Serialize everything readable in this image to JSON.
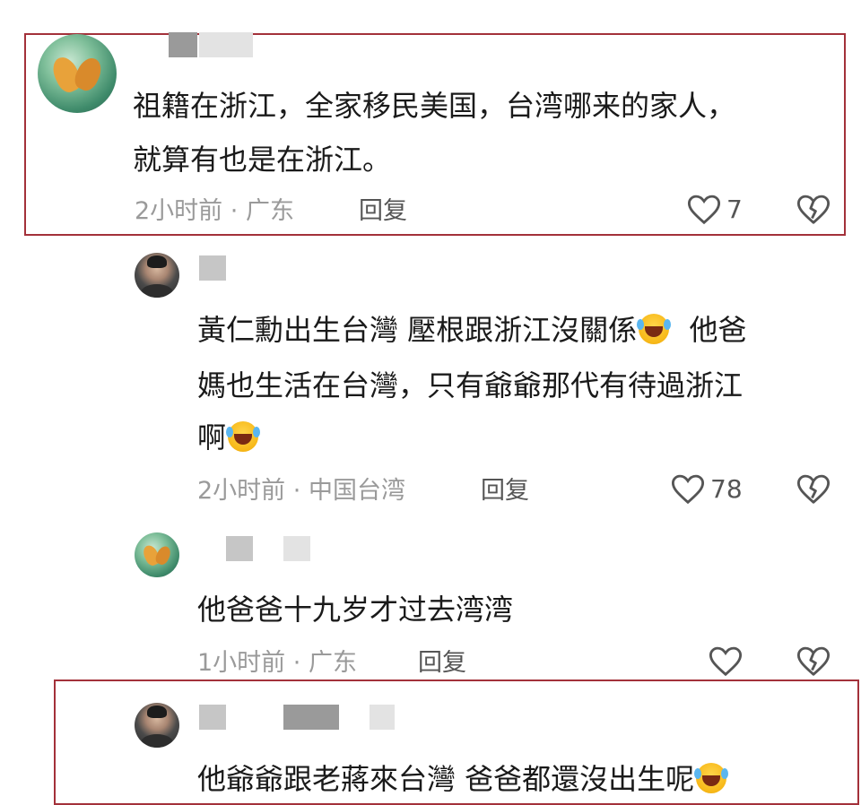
{
  "comments": [
    {
      "text_lines": [
        "祖籍在浙江，全家移民美国，台湾哪来的家人，",
        "就算有也是在浙江。"
      ],
      "time": "2小时前",
      "location": "广东",
      "reply_label": "回复",
      "likes": "7"
    },
    {
      "text_lines": [
        "黃仁勳出生台灣 壓根跟浙江沒關係",
        "他爸",
        "媽也生活在台灣，只有爺爺那代有待過浙江",
        "啊"
      ],
      "time": "2小时前",
      "location": "中国台湾",
      "reply_label": "回复",
      "likes": "78"
    },
    {
      "text_lines": [
        "他爸爸十九岁才过去湾湾"
      ],
      "time": "1小时前",
      "location": "广东",
      "reply_label": "回复",
      "likes": ""
    },
    {
      "text_lines": [
        "他爺爺跟老蔣來台灣 爸爸都還沒出生呢"
      ]
    }
  ],
  "separator": "·",
  "colors": {
    "highlight_border": "#a3313a",
    "meta_text": "#9a9a9a",
    "body_text": "#1a1a1a"
  },
  "icons": [
    "heart-icon",
    "dislike-icon",
    "laughing-emoji-icon"
  ]
}
